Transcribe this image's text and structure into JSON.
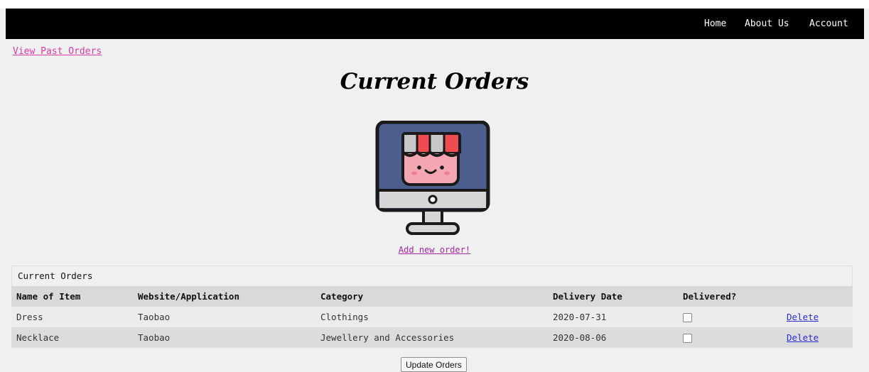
{
  "nav": {
    "home": "Home",
    "about": "About Us",
    "account": "Account"
  },
  "links": {
    "past_orders": "View Past Orders",
    "add_order": "Add new order!"
  },
  "page_title": "Current Orders",
  "icon": "shop-monitor-icon",
  "table": {
    "caption": "Current Orders",
    "headers": [
      "Name of Item",
      "Website/Application",
      "Category",
      "Delivery Date",
      "Delivered?"
    ],
    "rows": [
      {
        "name": "Dress",
        "site": "Taobao",
        "category": "Clothings",
        "date": "2020-07-31",
        "delivered": false,
        "action": "Delete"
      },
      {
        "name": "Necklace",
        "site": "Taobao",
        "category": "Jewellery and Accessories",
        "date": "2020-08-06",
        "delivered": false,
        "action": "Delete"
      }
    ]
  },
  "update_button": "Update Orders",
  "colors": {
    "nav_bg": "#000000",
    "past_link": "#d63ca8",
    "add_link": "#a626a4",
    "delete_link": "#2b2bd6"
  }
}
